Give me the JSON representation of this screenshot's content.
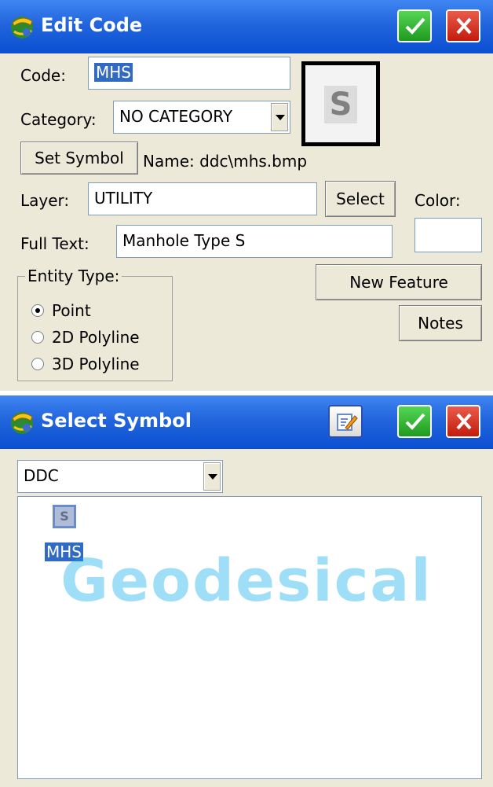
{
  "edit_code": {
    "title": "Edit Code",
    "code_label": "Code:",
    "code_value": "MHS",
    "symbol_preview_glyph": "S",
    "category_label": "Category:",
    "category_value": "NO CATEGORY",
    "set_symbol_label": "Set Symbol",
    "symbol_name": "Name: ddc\\mhs.bmp",
    "layer_label": "Layer:",
    "layer_value": "UTILITY",
    "select_label": "Select",
    "color_label": "Color:",
    "full_text_label": "Full Text:",
    "full_text_value": "Manhole Type S",
    "entity_type_label": "Entity Type:",
    "entity_types": [
      "Point",
      "2D Polyline",
      "3D Polyline"
    ],
    "entity_type_selected": "Point",
    "new_feature_label": "New Feature",
    "notes_label": "Notes"
  },
  "select_symbol": {
    "title": "Select Symbol",
    "library_value": "DDC",
    "symbols": [
      {
        "name": "MHS",
        "glyph": "S",
        "selected": true
      }
    ]
  },
  "watermark": "Geodesical",
  "colors": {
    "title_bar": "#0a4fd2",
    "ok": "#2aa52a",
    "cancel": "#d42a1a",
    "selection": "#316ac5",
    "panel": "#ece9d8"
  }
}
